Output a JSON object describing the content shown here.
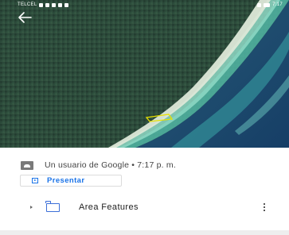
{
  "status_bar": {
    "carrier": "TELCEL",
    "time": "7:17"
  },
  "map": {
    "back_icon": "arrow-left-icon",
    "placemark_color": "#e8e000"
  },
  "info_panel": {
    "author_line": "Un usuario de Google • 7:17 p. m.",
    "present_button_label": "Presentar",
    "layers": [
      {
        "label": "Area Features",
        "icon": "folder-icon"
      }
    ]
  },
  "colors": {
    "accent": "#1a73e8",
    "folder": "#3c6fd8"
  }
}
